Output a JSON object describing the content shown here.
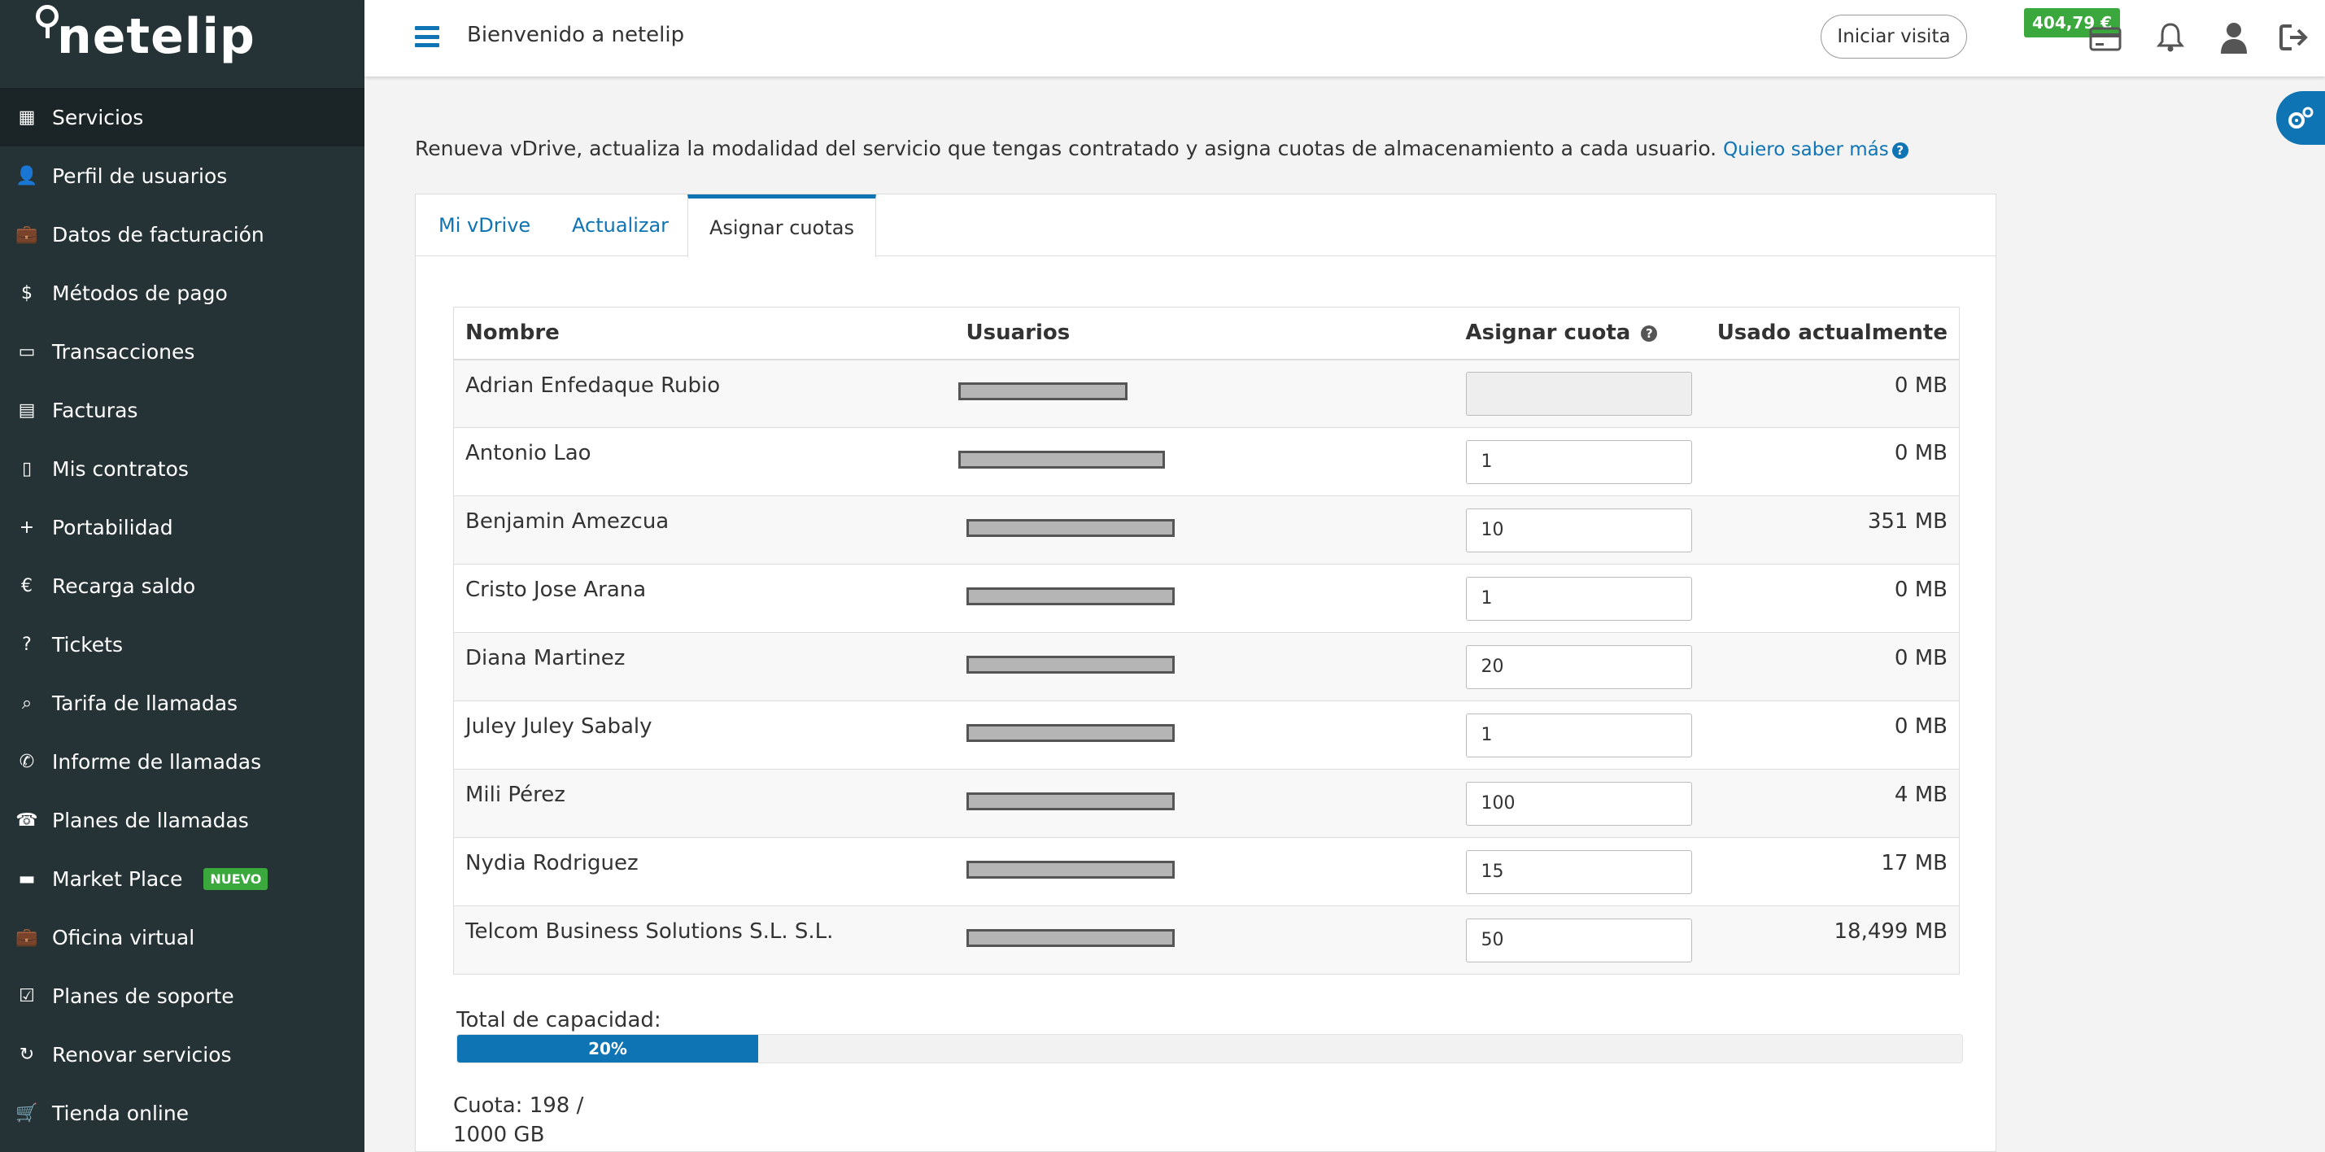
{
  "brand": {
    "logo_text": "netelip"
  },
  "sidebar": {
    "items": [
      {
        "label": "Servicios",
        "icon": "grid-icon",
        "active": true
      },
      {
        "label": "Perfil de usuarios",
        "icon": "user-icon"
      },
      {
        "label": "Datos de facturación",
        "icon": "briefcase-icon"
      },
      {
        "label": "Métodos de pago",
        "icon": "dollar-icon"
      },
      {
        "label": "Transacciones",
        "icon": "credit-card-icon"
      },
      {
        "label": "Facturas",
        "icon": "list-icon"
      },
      {
        "label": "Mis contratos",
        "icon": "document-icon"
      },
      {
        "label": "Portabilidad",
        "icon": "plus-icon"
      },
      {
        "label": "Recarga saldo",
        "icon": "euro-icon"
      },
      {
        "label": "Tickets",
        "icon": "question-icon"
      },
      {
        "label": "Tarifa de llamadas",
        "icon": "search-icon"
      },
      {
        "label": "Informe de llamadas",
        "icon": "phone-icon"
      },
      {
        "label": "Planes de llamadas",
        "icon": "telephone-icon"
      },
      {
        "label": "Market Place",
        "icon": "monitor-icon",
        "badge": "NUEVO"
      },
      {
        "label": "Oficina virtual",
        "icon": "briefcase-icon"
      },
      {
        "label": "Planes de soporte",
        "icon": "checkbox-icon"
      },
      {
        "label": "Renovar servicios",
        "icon": "refresh-icon"
      },
      {
        "label": "Tienda online",
        "icon": "cart-icon"
      }
    ]
  },
  "header": {
    "welcome": "Bienvenido a netelip",
    "visit_button": "Iniciar visita",
    "balance": "404,79 €"
  },
  "main": {
    "intro": "Renueva vDrive, actualiza la modalidad del servicio que tengas contratado y asigna cuotas de almacenamiento a cada usuario.",
    "learn_more": "Quiero saber más",
    "tabs": [
      {
        "label": "Mi vDrive",
        "active": false
      },
      {
        "label": "Actualizar",
        "active": false
      },
      {
        "label": "Asignar cuotas",
        "active": true
      }
    ],
    "table": {
      "headers": [
        "Nombre",
        "Usuarios",
        "Asignar cuota",
        "Usado actualmente"
      ],
      "rows": [
        {
          "name": "Adrian Enfedaque Rubio",
          "quota": "",
          "used": "0 MB",
          "disabled": true
        },
        {
          "name": "Antonio Lao",
          "quota": "1",
          "used": "0 MB"
        },
        {
          "name": "Benjamin Amezcua",
          "quota": "10",
          "used": "351 MB"
        },
        {
          "name": "Cristo Jose Arana",
          "quota": "1",
          "used": "0 MB"
        },
        {
          "name": "Diana Martinez",
          "quota": "20",
          "used": "0 MB"
        },
        {
          "name": "Juley Juley Sabaly",
          "quota": "1",
          "used": "0 MB"
        },
        {
          "name": "Mili Pérez",
          "quota": "100",
          "used": "4 MB"
        },
        {
          "name": "Nydia Rodriguez",
          "quota": "15",
          "used": "17 MB"
        },
        {
          "name": "Telcom Business Solutions S.L. S.L.",
          "quota": "50",
          "used": "18,499 MB"
        }
      ]
    },
    "capacity_label": "Total de capacidad:",
    "capacity_percent": 20,
    "capacity_text": "20%",
    "quota_line1": "Cuota: 198 /",
    "quota_line2": "1000 GB"
  },
  "colors": {
    "accent": "#0f74b3",
    "sidebar_bg": "#263336",
    "badge_green": "#3aa83c"
  }
}
